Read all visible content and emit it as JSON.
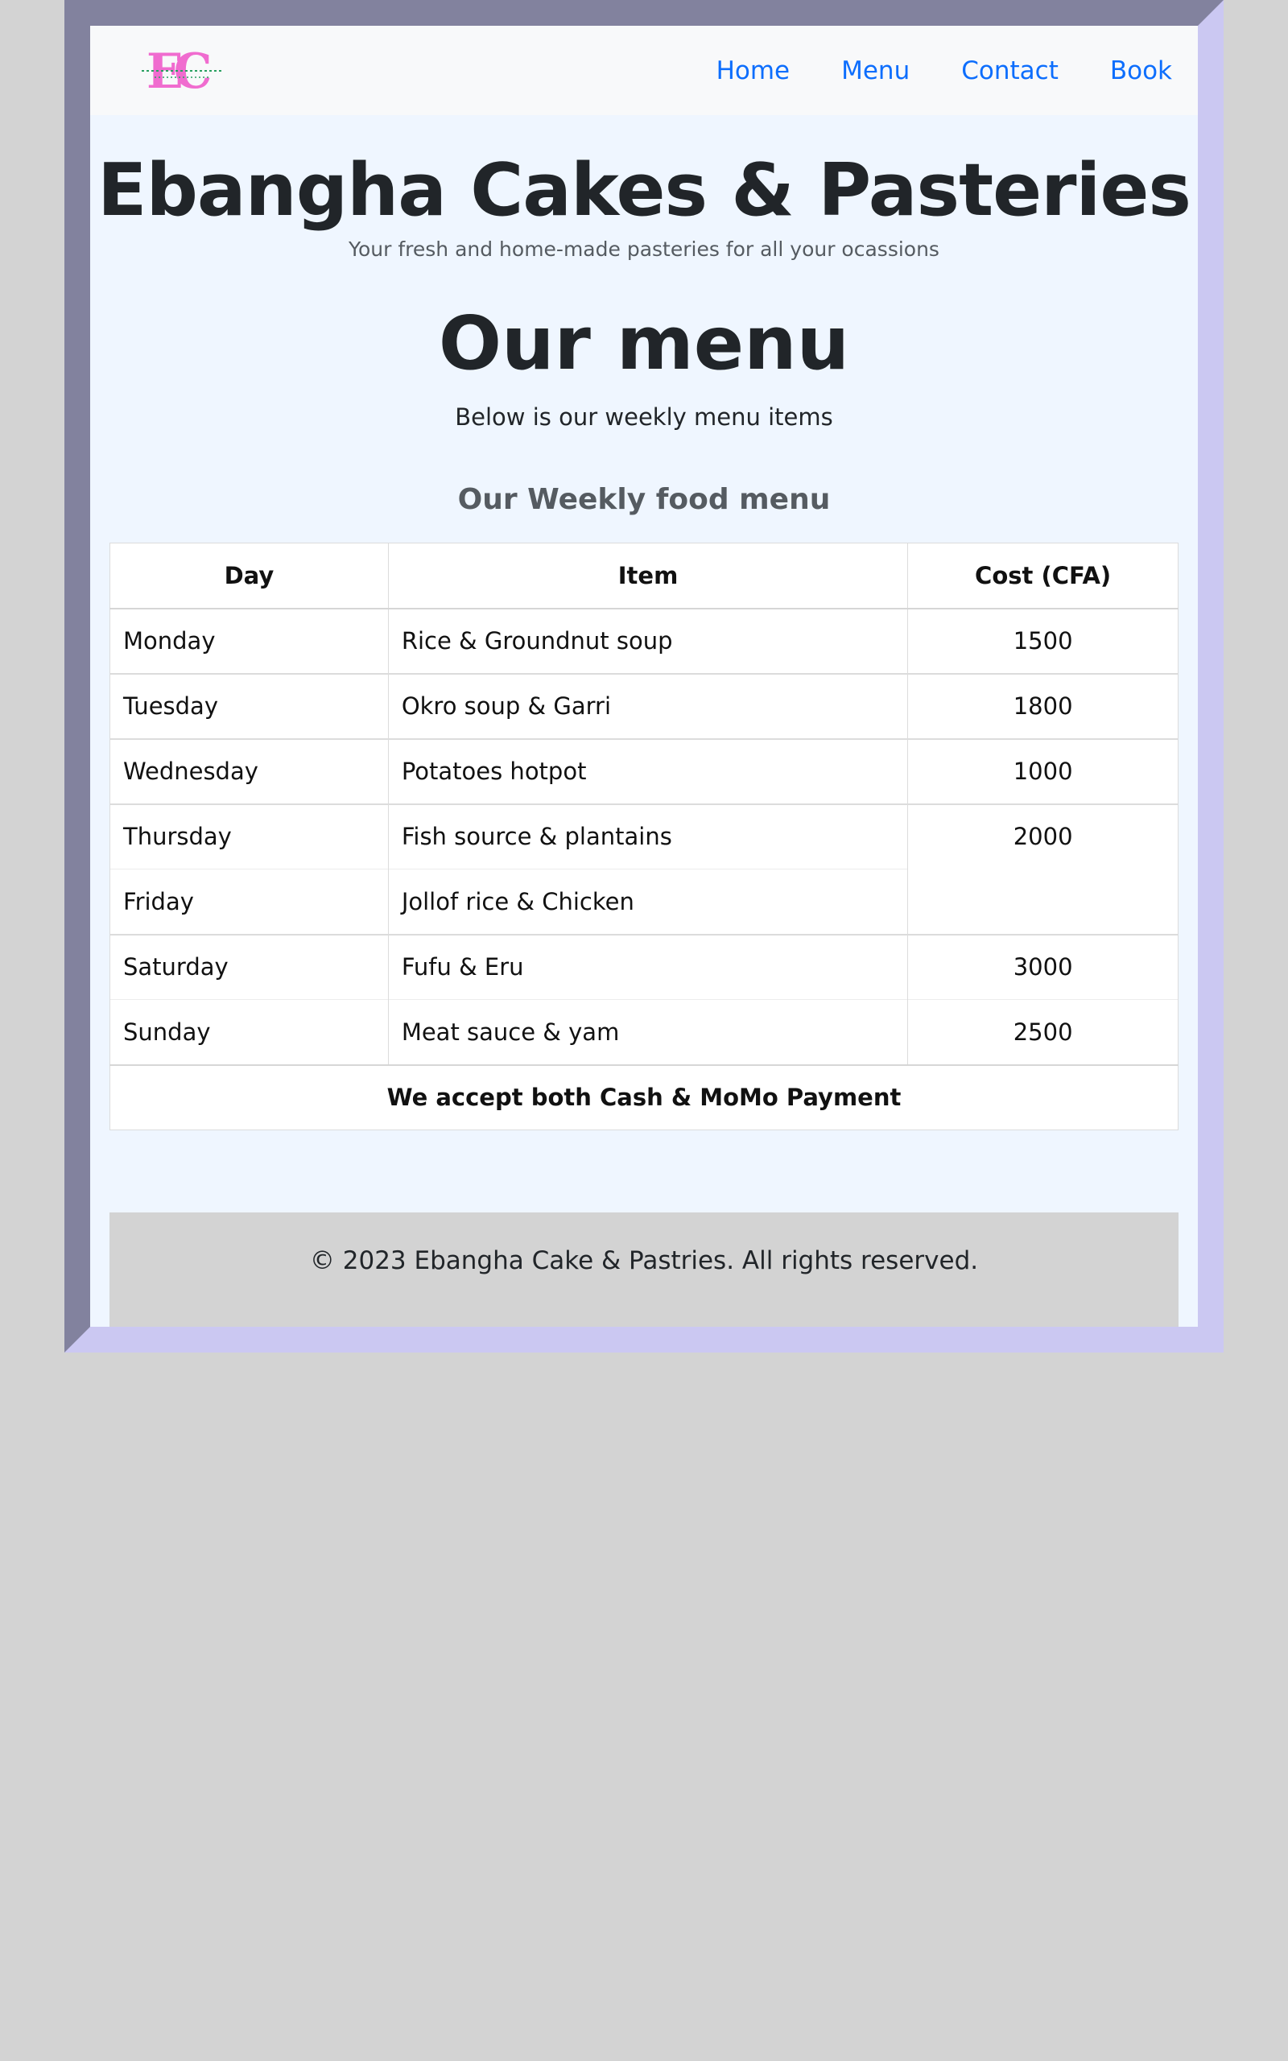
{
  "nav": {
    "logo_text": "EC",
    "logo_small_text": "EBANGHA CAKES PASTRIES",
    "links": [
      "Home",
      "Menu",
      "Contact",
      "Book"
    ]
  },
  "hero": {
    "title": "Ebangha Cakes & Pasteries",
    "subtitle": "Your fresh and home-made pasteries for all your ocassions"
  },
  "menu": {
    "title": "Our menu",
    "subtitle": "Below is our weekly menu items",
    "table_title": "Our Weekly food menu",
    "headers": [
      "Day",
      "Item",
      "Cost (CFA)"
    ],
    "rows": [
      {
        "day": "Monday",
        "item": "Rice & Groundnut soup",
        "cost": "1500"
      },
      {
        "day": "Tuesday",
        "item": "Okro soup & Garri",
        "cost": "1800"
      },
      {
        "day": "Wednesday",
        "item": "Potatoes hotpot",
        "cost": "1000"
      },
      {
        "day": "Thursday",
        "item": "Fish source & plantains",
        "cost": "2000"
      },
      {
        "day": "Friday",
        "item": "Jollof rice & Chicken",
        "cost": ""
      },
      {
        "day": "Saturday",
        "item": "Fufu & Eru",
        "cost": "3000"
      },
      {
        "day": "Sunday",
        "item": "Meat sauce & yam",
        "cost": "2500"
      }
    ],
    "footer_note": "We accept both Cash & MoMo Payment"
  },
  "footer": {
    "text": "© 2023 Ebangha Cake & Pastries. All rights reserved."
  },
  "colors": {
    "link": "#0d6efd",
    "logo": "#f06ccf",
    "frame_dark": "#82829e",
    "frame_light": "#cbc8f2",
    "content_bg": "#eff6ff"
  }
}
